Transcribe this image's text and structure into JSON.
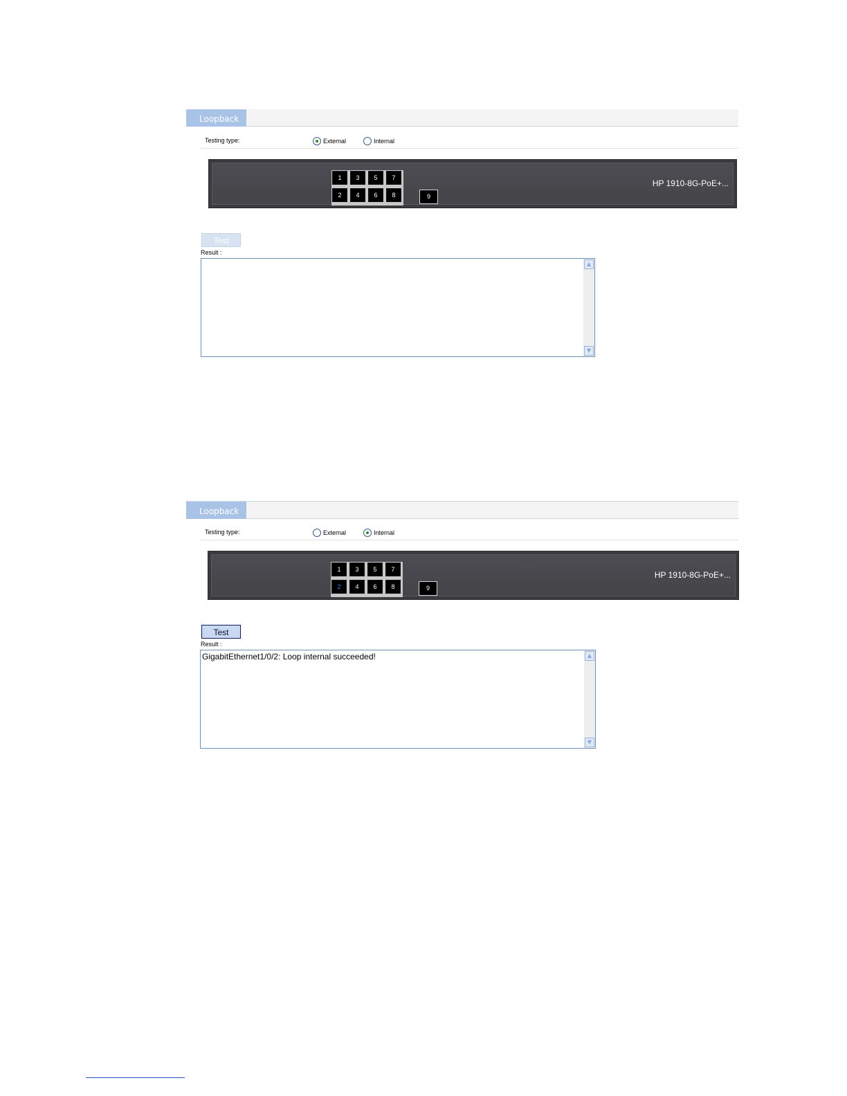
{
  "panels": [
    {
      "tab": "Loopback",
      "testing_type_label": "Testing type:",
      "options": [
        {
          "label": "External",
          "checked": true
        },
        {
          "label": "Internal",
          "checked": false
        }
      ],
      "device": {
        "model": "HP 1910-8G-PoE+...",
        "ports_top": [
          "1",
          "3",
          "5",
          "7"
        ],
        "ports_bottom": [
          "2",
          "4",
          "6",
          "8"
        ],
        "sfp_port": "9",
        "selected_port": null
      },
      "test_button": {
        "label": "Test",
        "enabled": false
      },
      "result_label": "Result :",
      "result_text": ""
    },
    {
      "tab": "Loopback",
      "testing_type_label": "Testing type:",
      "options": [
        {
          "label": "External",
          "checked": false
        },
        {
          "label": "Internal",
          "checked": true
        }
      ],
      "device": {
        "model": "HP 1910-8G-PoE+...",
        "ports_top": [
          "1",
          "3",
          "5",
          "7"
        ],
        "ports_bottom": [
          "2",
          "4",
          "6",
          "8"
        ],
        "sfp_port": "9",
        "selected_port": "2"
      },
      "test_button": {
        "label": "Test",
        "enabled": true
      },
      "result_label": "Result :",
      "result_text": "GigabitEthernet1/0/2: Loop internal succeeded!"
    }
  ],
  "colors": {
    "tab_bg": "#a9c3e6",
    "device_bg": "#4d4c52",
    "selected_port_text": "#4477ff",
    "radio_checked_dot": "#2d8a2d"
  }
}
